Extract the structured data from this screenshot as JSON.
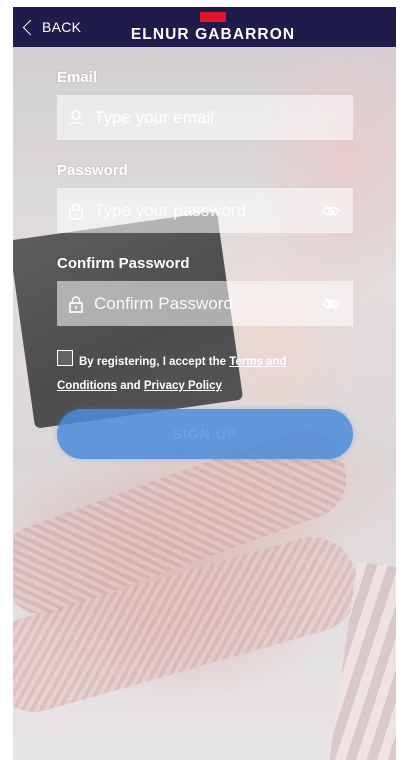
{
  "header": {
    "back_label": "BACK",
    "brand": "ELNUR GABARRON",
    "brand_mark_color": "#e1152e",
    "background_color": "#1f1b4a"
  },
  "form": {
    "email": {
      "label": "Email",
      "placeholder": "Type your email",
      "value": "",
      "icon": "user-icon"
    },
    "password": {
      "label": "Password",
      "placeholder": "Type your password",
      "value": "",
      "icon": "lock-icon",
      "toggle_icon": "eye-off-icon"
    },
    "confirm_password": {
      "label": "Confirm Password",
      "placeholder": "Confirm Password",
      "value": "",
      "icon": "lock-icon",
      "toggle_icon": "eye-off-icon"
    }
  },
  "terms": {
    "checked": false,
    "prefix": "By registering, I accept the ",
    "terms_link": "Terms and Conditions",
    "conjunction": " and ",
    "privacy_link": "Privacy Policy"
  },
  "submit": {
    "label": "SIGN UP",
    "color": "#4a8cda"
  }
}
